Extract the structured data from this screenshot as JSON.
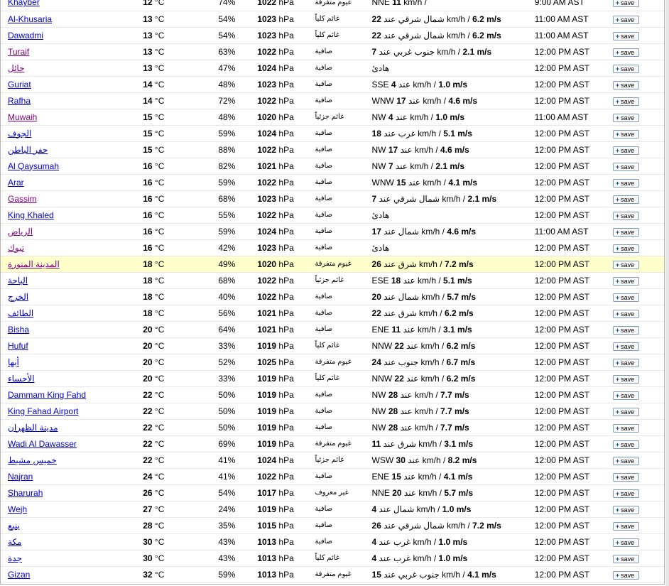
{
  "save_label": "save",
  "rows": [
    {
      "city": "Khayber",
      "visited": false,
      "temp": "12",
      "unit": "°C",
      "humidity": "74%",
      "pressure": "1022",
      "pressure_unit": "hPa",
      "condition": "غيوم متفرقة",
      "wind_dir": "NNE",
      "wind_speed": "11",
      "wind_text": "km/h /",
      "wind_ms": "",
      "time": "9:00 AM AST"
    },
    {
      "city": "Al-Khusaria",
      "visited": false,
      "temp": "13",
      "unit": "°C",
      "humidity": "54%",
      "pressure": "1023",
      "pressure_unit": "hPa",
      "condition": "غائم كلياً",
      "wind_dir": "",
      "wind_speed": "22",
      "wind_text": "شمال شرقي عند km/h /",
      "wind_ms": "6.2 m/s",
      "time": "11:00 AM AST"
    },
    {
      "city": "Dawadmi",
      "visited": false,
      "temp": "13",
      "unit": "°C",
      "humidity": "54%",
      "pressure": "1023",
      "pressure_unit": "hPa",
      "condition": "غائم كلياً",
      "wind_dir": "",
      "wind_speed": "22",
      "wind_text": "شمال شرقي عند km/h /",
      "wind_ms": "6.2 m/s",
      "time": "11:00 AM AST"
    },
    {
      "city": "Turaif",
      "visited": true,
      "temp": "13",
      "unit": "°C",
      "humidity": "63%",
      "pressure": "1022",
      "pressure_unit": "hPa",
      "condition": "صافية",
      "wind_dir": "",
      "wind_speed": "7",
      "wind_text": "جنوب غربي عند km/h /",
      "wind_ms": "2.1 m/s",
      "time": "12:00 PM AST"
    },
    {
      "city": "حائل",
      "visited": true,
      "temp": "13",
      "unit": "°C",
      "humidity": "47%",
      "pressure": "1024",
      "pressure_unit": "hPa",
      "condition": "صافية",
      "wind_dir": "",
      "wind_speed": "",
      "wind_text": "هادئ",
      "wind_ms": "",
      "time": "12:00 PM AST"
    },
    {
      "city": "Guriat",
      "visited": false,
      "temp": "14",
      "unit": "°C",
      "humidity": "48%",
      "pressure": "1023",
      "pressure_unit": "hPa",
      "condition": "صافية",
      "wind_dir": "SSE",
      "wind_speed": "4",
      "wind_text": "عند km/h /",
      "wind_ms": "1.0 m/s",
      "time": "12:00 PM AST"
    },
    {
      "city": "Rafha",
      "visited": false,
      "temp": "14",
      "unit": "°C",
      "humidity": "72%",
      "pressure": "1022",
      "pressure_unit": "hPa",
      "condition": "صافية",
      "wind_dir": "WNW",
      "wind_speed": "17",
      "wind_text": "عند km/h /",
      "wind_ms": "4.6 m/s",
      "time": "12:00 PM AST"
    },
    {
      "city": "Muwaih",
      "visited": true,
      "temp": "15",
      "unit": "°C",
      "humidity": "48%",
      "pressure": "1020",
      "pressure_unit": "hPa",
      "condition": "غائم جزئياً",
      "wind_dir": "NW",
      "wind_speed": "4",
      "wind_text": "عند km/h /",
      "wind_ms": "1.0 m/s",
      "time": "11:00 AM AST"
    },
    {
      "city": "الجوف",
      "visited": false,
      "temp": "15",
      "unit": "°C",
      "humidity": "59%",
      "pressure": "1024",
      "pressure_unit": "hPa",
      "condition": "صافية",
      "wind_dir": "",
      "wind_speed": "18",
      "wind_text": "غرب عند km/h /",
      "wind_ms": "5.1 m/s",
      "time": "12:00 PM AST"
    },
    {
      "city": "حفر الباطن",
      "visited": false,
      "temp": "15",
      "unit": "°C",
      "humidity": "88%",
      "pressure": "1022",
      "pressure_unit": "hPa",
      "condition": "صافية",
      "wind_dir": "NW",
      "wind_speed": "17",
      "wind_text": "عند km/h /",
      "wind_ms": "4.6 m/s",
      "time": "12:00 PM AST"
    },
    {
      "city": "Al Qaysumah",
      "visited": false,
      "temp": "16",
      "unit": "°C",
      "humidity": "82%",
      "pressure": "1021",
      "pressure_unit": "hPa",
      "condition": "صافية",
      "wind_dir": "NW",
      "wind_speed": "7",
      "wind_text": "عند km/h /",
      "wind_ms": "2.1 m/s",
      "time": "12:00 PM AST"
    },
    {
      "city": "Arar",
      "visited": false,
      "temp": "16",
      "unit": "°C",
      "humidity": "59%",
      "pressure": "1022",
      "pressure_unit": "hPa",
      "condition": "صافية",
      "wind_dir": "WNW",
      "wind_speed": "15",
      "wind_text": "عند km/h /",
      "wind_ms": "4.1 m/s",
      "time": "12:00 PM AST"
    },
    {
      "city": "Gassim",
      "visited": true,
      "temp": "16",
      "unit": "°C",
      "humidity": "68%",
      "pressure": "1023",
      "pressure_unit": "hPa",
      "condition": "صافية",
      "wind_dir": "",
      "wind_speed": "7",
      "wind_text": "شمال شرقي عند km/h /",
      "wind_ms": "2.1 m/s",
      "time": "12:00 PM AST"
    },
    {
      "city": "King Khaled",
      "visited": false,
      "temp": "16",
      "unit": "°C",
      "humidity": "55%",
      "pressure": "1022",
      "pressure_unit": "hPa",
      "condition": "صافية",
      "wind_dir": "",
      "wind_speed": "",
      "wind_text": "هادئ",
      "wind_ms": "",
      "time": "12:00 PM AST"
    },
    {
      "city": "الرياض",
      "visited": true,
      "temp": "16",
      "unit": "°C",
      "humidity": "59%",
      "pressure": "1024",
      "pressure_unit": "hPa",
      "condition": "صافية",
      "wind_dir": "",
      "wind_speed": "17",
      "wind_text": "شمال عند km/h /",
      "wind_ms": "4.6 m/s",
      "time": "11:00 AM AST"
    },
    {
      "city": "تبوك",
      "visited": true,
      "temp": "16",
      "unit": "°C",
      "humidity": "42%",
      "pressure": "1023",
      "pressure_unit": "hPa",
      "condition": "صافية",
      "wind_dir": "",
      "wind_speed": "",
      "wind_text": "هادئ",
      "wind_ms": "",
      "time": "12:00 PM AST"
    },
    {
      "city": "المدينة المنورة",
      "visited": true,
      "highlight": true,
      "temp": "18",
      "unit": "°C",
      "humidity": "49%",
      "pressure": "1020",
      "pressure_unit": "hPa",
      "condition": "غيوم متفرقة",
      "wind_dir": "",
      "wind_speed": "26",
      "wind_text": "شرق عند km/h /",
      "wind_ms": "7.2 m/s",
      "time": "12:00 PM AST"
    },
    {
      "city": "الباحة",
      "visited": false,
      "temp": "18",
      "unit": "°C",
      "humidity": "68%",
      "pressure": "1022",
      "pressure_unit": "hPa",
      "condition": "غائم جزئياً",
      "wind_dir": "ESE",
      "wind_speed": "18",
      "wind_text": "عند km/h /",
      "wind_ms": "5.1 m/s",
      "time": "12:00 PM AST"
    },
    {
      "city": "الخرج",
      "visited": false,
      "temp": "18",
      "unit": "°C",
      "humidity": "40%",
      "pressure": "1022",
      "pressure_unit": "hPa",
      "condition": "صافية",
      "wind_dir": "",
      "wind_speed": "20",
      "wind_text": "شمال عند km/h /",
      "wind_ms": "5.7 m/s",
      "time": "12:00 PM AST"
    },
    {
      "city": "الطائف",
      "visited": false,
      "temp": "18",
      "unit": "°C",
      "humidity": "56%",
      "pressure": "1021",
      "pressure_unit": "hPa",
      "condition": "صافية",
      "wind_dir": "",
      "wind_speed": "22",
      "wind_text": "شرق عند km/h /",
      "wind_ms": "6.2 m/s",
      "time": "12:00 PM AST"
    },
    {
      "city": "Bisha",
      "visited": false,
      "temp": "20",
      "unit": "°C",
      "humidity": "64%",
      "pressure": "1021",
      "pressure_unit": "hPa",
      "condition": "صافية",
      "wind_dir": "ENE",
      "wind_speed": "11",
      "wind_text": "عند km/h /",
      "wind_ms": "3.1 m/s",
      "time": "12:00 PM AST"
    },
    {
      "city": "Hufuf",
      "visited": false,
      "temp": "20",
      "unit": "°C",
      "humidity": "33%",
      "pressure": "1019",
      "pressure_unit": "hPa",
      "condition": "غائم كلياً",
      "wind_dir": "NNW",
      "wind_speed": "22",
      "wind_text": "عند km/h /",
      "wind_ms": "6.2 m/s",
      "time": "12:00 PM AST"
    },
    {
      "city": "أبها",
      "visited": false,
      "temp": "20",
      "unit": "°C",
      "humidity": "52%",
      "pressure": "1025",
      "pressure_unit": "hPa",
      "condition": "غيوم متفرقة",
      "wind_dir": "",
      "wind_speed": "24",
      "wind_text": "جنوب عند km/h /",
      "wind_ms": "6.7 m/s",
      "time": "12:00 PM AST"
    },
    {
      "city": "الأحساء",
      "visited": false,
      "temp": "20",
      "unit": "°C",
      "humidity": "33%",
      "pressure": "1019",
      "pressure_unit": "hPa",
      "condition": "غائم كلياً",
      "wind_dir": "NNW",
      "wind_speed": "22",
      "wind_text": "عند km/h /",
      "wind_ms": "6.2 m/s",
      "time": "12:00 PM AST"
    },
    {
      "city": "Dammam King Fahd",
      "visited": false,
      "temp": "22",
      "unit": "°C",
      "humidity": "50%",
      "pressure": "1019",
      "pressure_unit": "hPa",
      "condition": "صافية",
      "wind_dir": "NW",
      "wind_speed": "28",
      "wind_text": "عند km/h /",
      "wind_ms": "7.7 m/s",
      "time": "12:00 PM AST"
    },
    {
      "city": "King Fahad Airport",
      "visited": false,
      "temp": "22",
      "unit": "°C",
      "humidity": "50%",
      "pressure": "1019",
      "pressure_unit": "hPa",
      "condition": "صافية",
      "wind_dir": "NW",
      "wind_speed": "28",
      "wind_text": "عند km/h /",
      "wind_ms": "7.7 m/s",
      "time": "12:00 PM AST"
    },
    {
      "city": "مدينة الظهران",
      "visited": false,
      "temp": "22",
      "unit": "°C",
      "humidity": "50%",
      "pressure": "1019",
      "pressure_unit": "hPa",
      "condition": "صافية",
      "wind_dir": "NW",
      "wind_speed": "28",
      "wind_text": "عند km/h /",
      "wind_ms": "7.7 m/s",
      "time": "12:00 PM AST"
    },
    {
      "city": "Wadi Al Dawasser",
      "visited": false,
      "temp": "22",
      "unit": "°C",
      "humidity": "69%",
      "pressure": "1019",
      "pressure_unit": "hPa",
      "condition": "غيوم متفرقة",
      "wind_dir": "",
      "wind_speed": "11",
      "wind_text": "شرق عند km/h /",
      "wind_ms": "3.1 m/s",
      "time": "12:00 PM AST"
    },
    {
      "city": "خميس مشيط",
      "visited": false,
      "temp": "22",
      "unit": "°C",
      "humidity": "41%",
      "pressure": "1024",
      "pressure_unit": "hPa",
      "condition": "غائم جزئياً",
      "wind_dir": "WSW",
      "wind_speed": "30",
      "wind_text": "عند km/h /",
      "wind_ms": "8.2 m/s",
      "time": "12:00 PM AST"
    },
    {
      "city": "Najran",
      "visited": false,
      "temp": "24",
      "unit": "°C",
      "humidity": "41%",
      "pressure": "1022",
      "pressure_unit": "hPa",
      "condition": "صافية",
      "wind_dir": "ENE",
      "wind_speed": "15",
      "wind_text": "عند km/h /",
      "wind_ms": "4.1 m/s",
      "time": "12:00 PM AST"
    },
    {
      "city": "Sharurah",
      "visited": false,
      "temp": "26",
      "unit": "°C",
      "humidity": "54%",
      "pressure": "1017",
      "pressure_unit": "hPa",
      "condition": "غير معروف",
      "wind_dir": "NNE",
      "wind_speed": "20",
      "wind_text": "عند km/h /",
      "wind_ms": "5.7 m/s",
      "time": "12:00 PM AST"
    },
    {
      "city": "Wejh",
      "visited": false,
      "temp": "27",
      "unit": "°C",
      "humidity": "24%",
      "pressure": "1019",
      "pressure_unit": "hPa",
      "condition": "صافية",
      "wind_dir": "",
      "wind_speed": "4",
      "wind_text": "شمال عند km/h /",
      "wind_ms": "1.0 m/s",
      "time": "12:00 PM AST"
    },
    {
      "city": "ينبع",
      "visited": false,
      "temp": "28",
      "unit": "°C",
      "humidity": "35%",
      "pressure": "1015",
      "pressure_unit": "hPa",
      "condition": "صافية",
      "wind_dir": "",
      "wind_speed": "26",
      "wind_text": "شمال شرقي عند km/h /",
      "wind_ms": "7.2 m/s",
      "time": "12:00 PM AST"
    },
    {
      "city": "مكة",
      "visited": false,
      "temp": "30",
      "unit": "°C",
      "humidity": "43%",
      "pressure": "1013",
      "pressure_unit": "hPa",
      "condition": "صافية",
      "wind_dir": "",
      "wind_speed": "4",
      "wind_text": "غرب عند km/h /",
      "wind_ms": "1.0 m/s",
      "time": "12:00 PM AST"
    },
    {
      "city": "جدة",
      "visited": false,
      "temp": "30",
      "unit": "°C",
      "humidity": "43%",
      "pressure": "1013",
      "pressure_unit": "hPa",
      "condition": "غائم كلياً",
      "wind_dir": "",
      "wind_speed": "4",
      "wind_text": "غرب عند km/h /",
      "wind_ms": "1.0 m/s",
      "time": "12:00 PM AST"
    },
    {
      "city": "Gizan",
      "visited": false,
      "temp": "32",
      "unit": "°C",
      "humidity": "59%",
      "pressure": "1013",
      "pressure_unit": "hPa",
      "condition": "غيوم متفرقة",
      "wind_dir": "",
      "wind_speed": "15",
      "wind_text": "جنوب غربي عند km/h /",
      "wind_ms": "4.1 m/s",
      "time": "12:00 PM AST"
    }
  ]
}
